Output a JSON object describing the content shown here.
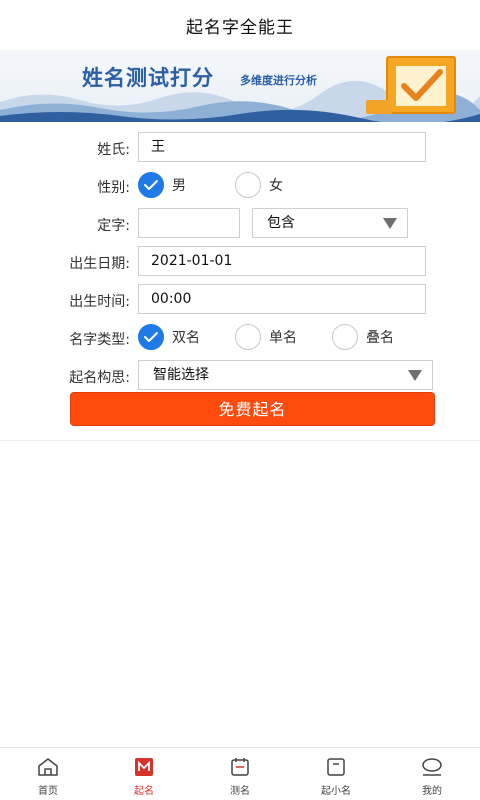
{
  "header": {
    "title": "起名字全能王"
  },
  "banner": {
    "title": "姓名测试打分",
    "subtitle": "多维度进行分析"
  },
  "form": {
    "surname": {
      "label": "姓氏:",
      "value": "王"
    },
    "gender": {
      "label": "性别:",
      "options": [
        "男",
        "女"
      ],
      "selected": "男"
    },
    "fixed_char": {
      "label": "定字:",
      "value": "",
      "mode": "包含"
    },
    "birth_date": {
      "label": "出生日期:",
      "value": "2021-01-01"
    },
    "birth_time": {
      "label": "出生时间:",
      "value": "00:00"
    },
    "name_type": {
      "label": "名字类型:",
      "options": [
        "双名",
        "单名",
        "叠名"
      ],
      "selected": "双名"
    },
    "concept": {
      "label": "起名构思:",
      "value": "智能选择"
    },
    "submit_label": "免费起名"
  },
  "tabbar": {
    "items": [
      {
        "label": "首页",
        "icon": "home-icon",
        "active": false
      },
      {
        "label": "起名",
        "icon": "naming-icon",
        "active": true
      },
      {
        "label": "测名",
        "icon": "calendar-icon",
        "active": false
      },
      {
        "label": "起小名",
        "icon": "card-icon",
        "active": false
      },
      {
        "label": "我的",
        "icon": "user-icon",
        "active": false
      }
    ]
  },
  "colors": {
    "accent": "#1e7ae6",
    "submit": "#ff4b0e",
    "active_tab": "#d6342b"
  }
}
